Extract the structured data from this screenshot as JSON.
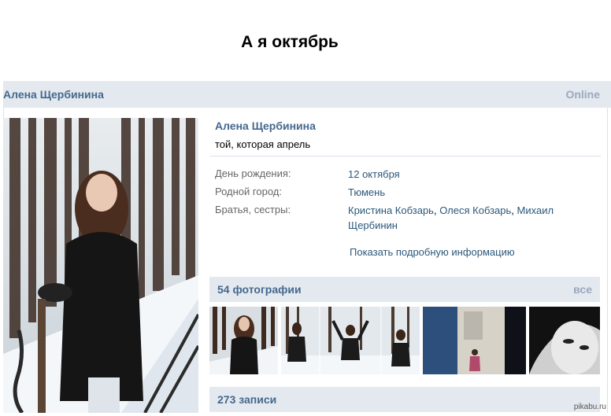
{
  "caption": "А я октябрь",
  "header": {
    "name": "Алена Щербинина",
    "status": "Online"
  },
  "profile": {
    "name": "Алена Щербинина",
    "status_text": "той, которая апрель",
    "fields": [
      {
        "label": "День рождения:",
        "value": "12 октября"
      },
      {
        "label": "Родной город:",
        "value": "Тюмень"
      },
      {
        "label": "Братья, сестры:",
        "siblings": [
          "Кристина Кобзарь",
          "Олеся Кобзарь",
          "Михаил",
          "Щербинин"
        ],
        "separator": ", "
      }
    ],
    "more_link": "Показать подробную информацию"
  },
  "photos": {
    "title": "54 фотографии",
    "all_link": "все",
    "thumbnails": [
      "photo-1",
      "photo-2",
      "photo-3",
      "photo-4",
      "photo-5"
    ]
  },
  "posts": {
    "title": "273 записи"
  },
  "watermark": "pikabu.ru",
  "colors": {
    "link": "#2b587a",
    "header_bg": "#e4e9ef",
    "name": "#45688e",
    "muted": "#99a9bd"
  }
}
